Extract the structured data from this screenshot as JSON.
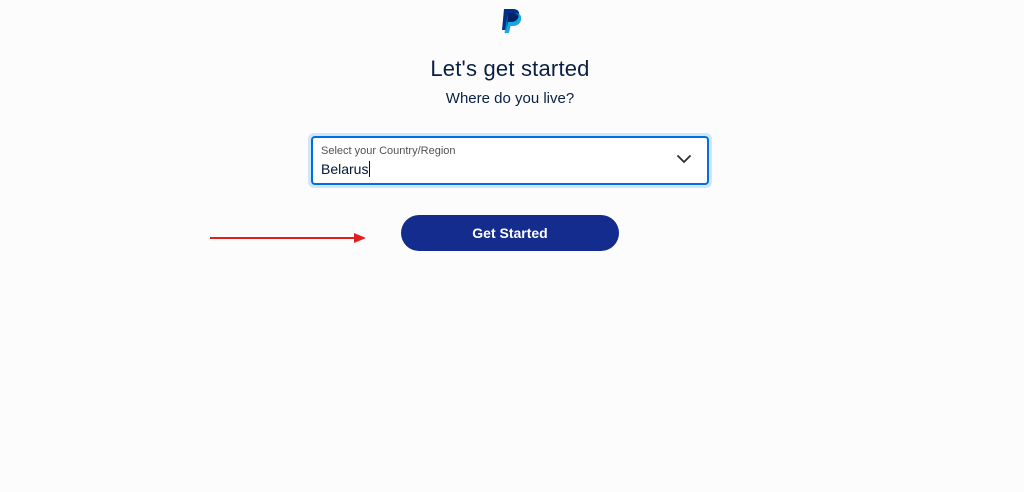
{
  "brand": {
    "logo_icon": "paypal-logo-icon",
    "colors": {
      "primary_dark": "#142c8e",
      "logo_dark": "#003087",
      "logo_light": "#009cde",
      "focus": "#0070e0",
      "annotation": "#e02020"
    }
  },
  "header": {
    "title": "Let's get started",
    "subtitle": "Where do you live?"
  },
  "country_select": {
    "label": "Select your Country/Region",
    "value": "Belarus",
    "icon": "chevron-down-icon"
  },
  "actions": {
    "get_started_label": "Get Started"
  },
  "annotation": {
    "icon": "red-arrow-annotation"
  }
}
